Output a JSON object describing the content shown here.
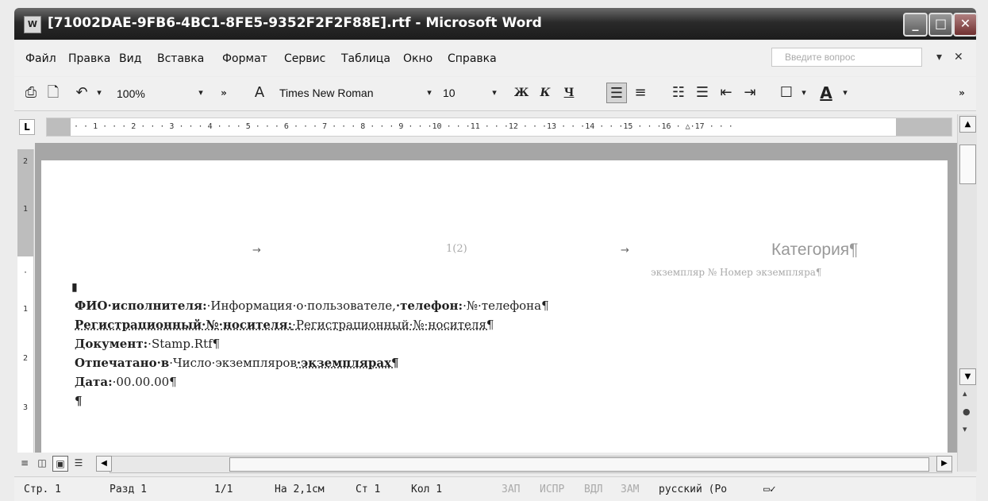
{
  "window": {
    "title": "[71002DAE-9FB6-4BC1-8FE5-9352F2F2F88E].rtf - Microsoft Word",
    "minimize": "_",
    "maximize": "□",
    "close": "✕"
  },
  "menu": {
    "items": [
      "Файл",
      "Правка",
      "Вид",
      "Вставка",
      "Формат",
      "Сервис",
      "Таблица",
      "Окно",
      "Справка"
    ],
    "help_placeholder": "Введите вопрос",
    "help_dropdown": "▾",
    "close_doc": "✕"
  },
  "toolbar": {
    "zoom": "100%",
    "font": "Times New Roman",
    "size": "10",
    "bold": "Ж",
    "italic": "К",
    "underline": "Ч",
    "more": "»"
  },
  "ruler": {
    "ticks": "· · 1 · · · 2 · · · 3 · · · 4 · · · 5 · · · 6 · · · 7 · · · 8 · · · 9 · · ·10 · · ·11 · · ·12 · · ·13 · · ·14 · · ·15 · · ·16 · △·17 · · ·"
  },
  "vruler": [
    "2",
    "1",
    "·",
    "1",
    "2",
    "3"
  ],
  "document": {
    "header_page_number": "1(2)",
    "header_category": "Категория¶",
    "header_copy": "экземпляр № Номер экземпляра¶",
    "cursor_mark": "▮",
    "lines": [
      {
        "label": "ФИО·исполнителя:",
        "value": "·Информация·о·пользователе,",
        "label2": "·телефон:",
        "value2": "·№·телефона¶"
      },
      {
        "label": "Регистрационный·№·носителя:",
        "value": "·Регистрационный·№·носителя¶"
      },
      {
        "label": "Документ:",
        "value": "·Stamp.Rtf¶"
      },
      {
        "label": "Отпечатано·в",
        "value": "·Число·экземпляров",
        "label2": "·экземплярах¶"
      },
      {
        "label": "Дата:",
        "value": "·00.00.00¶"
      }
    ],
    "empty_para": "¶"
  },
  "status": {
    "page": "Стр. 1",
    "section": "Разд 1",
    "pages": "1/1",
    "at": "На 2,1см",
    "line": "Ст 1",
    "col": "Кол 1",
    "rec": "ЗАП",
    "trk": "ИСПР",
    "ext": "ВДЛ",
    "ovr": "ЗАМ",
    "lang": "русский (Ро"
  }
}
